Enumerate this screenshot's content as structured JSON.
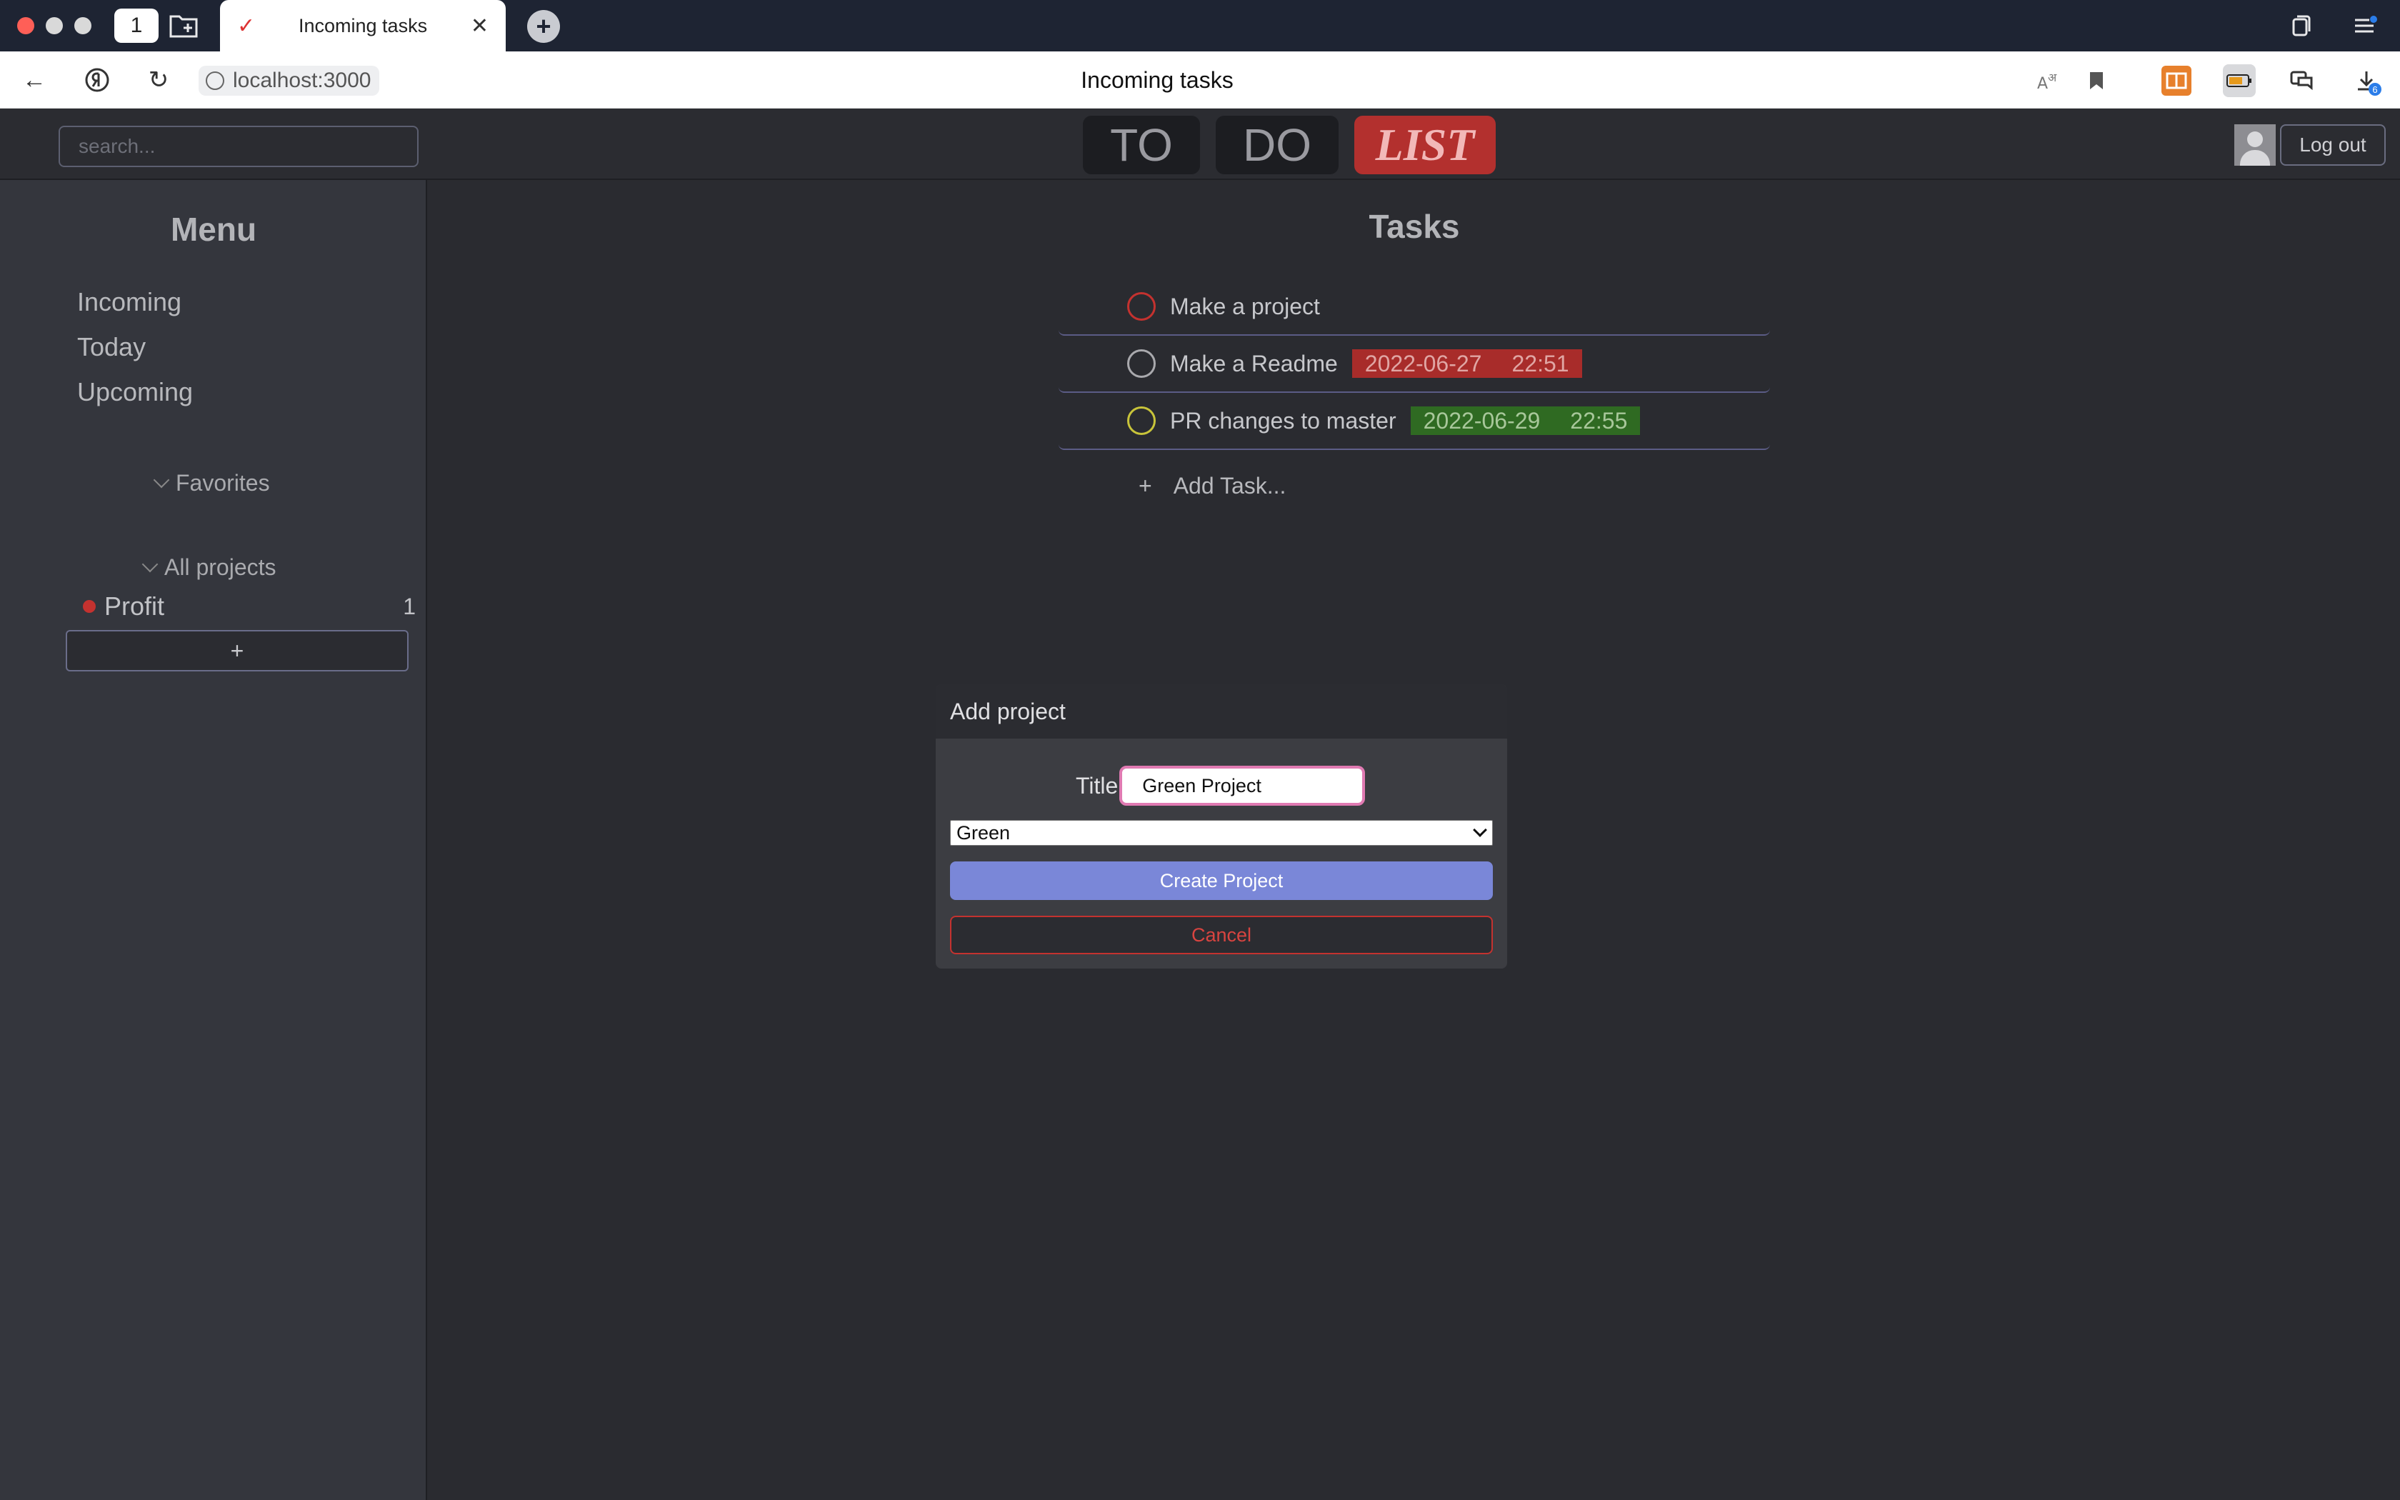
{
  "browser": {
    "tab_title": "Incoming tasks",
    "home_tab_number": "1",
    "url": "localhost:3000",
    "page_title": "Incoming tasks",
    "downloads_badge": "6"
  },
  "header": {
    "search_placeholder": "search...",
    "logo": [
      "TO",
      "DO",
      "LIST"
    ],
    "logout_label": "Log out"
  },
  "sidebar": {
    "title": "Menu",
    "items": [
      {
        "label": "Incoming"
      },
      {
        "label": "Today"
      },
      {
        "label": "Upcoming"
      }
    ],
    "favorites_label": "Favorites",
    "all_projects_label": "All projects",
    "projects": [
      {
        "name": "Profit",
        "count": "1",
        "color": "#c4322f"
      }
    ],
    "add_project_label": "+"
  },
  "main": {
    "title": "Tasks",
    "tasks": [
      {
        "title": "Make a project",
        "date": "",
        "time": "",
        "circle_color": "#c4322f",
        "badge_color": ""
      },
      {
        "title": "Make a Readme",
        "date": "2022-06-27",
        "time": "22:51",
        "circle_color": "#a9a9ad",
        "badge_color": "#a82c2a"
      },
      {
        "title": "PR changes to master",
        "date": "2022-06-29",
        "time": "22:55",
        "circle_color": "#c8c43a",
        "badge_color": "#2f6a22"
      }
    ],
    "add_task_plus": "+",
    "add_task_label": "Add Task..."
  },
  "modal": {
    "title": "Add project",
    "title_label": "Title",
    "title_value": "Green Project",
    "color_selected": "Green",
    "create_label": "Create Project",
    "cancel_label": "Cancel"
  }
}
